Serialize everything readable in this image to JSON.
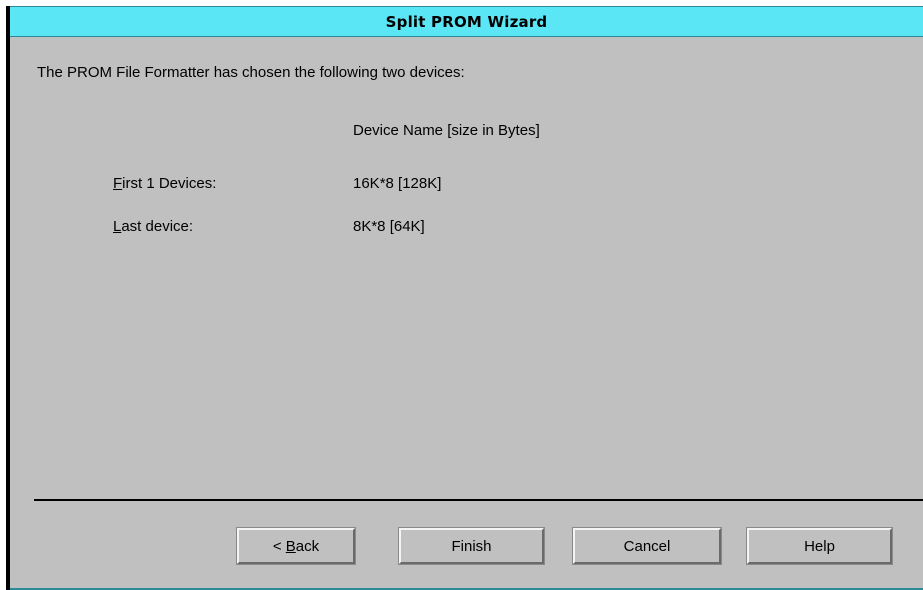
{
  "window": {
    "title": "Split PROM Wizard"
  },
  "dialog": {
    "intro": "The PROM File Formatter has chosen the following two devices:",
    "column_header": "Device Name [size in Bytes]",
    "rows": [
      {
        "label_mnemonic": "F",
        "label_rest": "irst 1 Devices:",
        "value": "16K*8  [128K]"
      },
      {
        "label_mnemonic": "L",
        "label_rest": "ast device:",
        "value": "8K*8  [64K]"
      }
    ]
  },
  "buttons": {
    "back_prefix": "< ",
    "back_mnemonic": "B",
    "back_rest": "ack",
    "finish": "Finish",
    "cancel": "Cancel",
    "help": "Help"
  },
  "colors": {
    "titlebar": "#5ae6f4",
    "background": "#c0c0c0"
  }
}
